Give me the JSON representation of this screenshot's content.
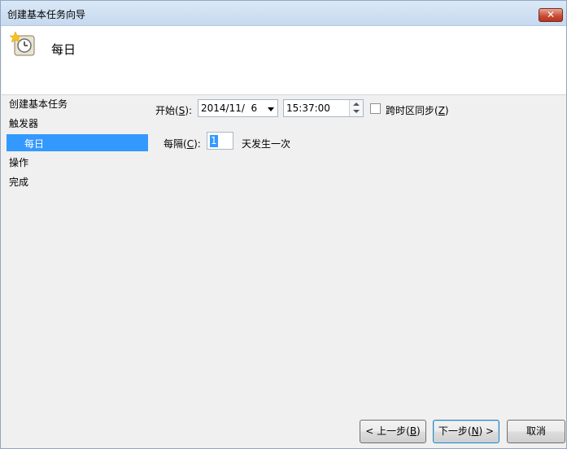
{
  "window": {
    "title": "创建基本任务向导",
    "close_label": "✕"
  },
  "header": {
    "title": "每日",
    "icon": "clock-wizard-icon"
  },
  "nav": {
    "items": [
      {
        "label": "创建基本任务",
        "selected": false
      },
      {
        "label": "触发器",
        "selected": false
      },
      {
        "label": "每日",
        "selected": true
      },
      {
        "label": "操作",
        "selected": false
      },
      {
        "label": "完成",
        "selected": false
      }
    ]
  },
  "form": {
    "start_label_pre": "开始(",
    "start_label_key": "S",
    "start_label_post": "):",
    "start_date": "2014/11/  6",
    "start_time": "15:37:00",
    "sync_label_pre": "跨时区同步(",
    "sync_label_key": "Z",
    "sync_label_post": ")",
    "sync_checked": false,
    "recur_label_pre": "每隔(",
    "recur_label_key": "C",
    "recur_label_post": "):",
    "recur_value": "1",
    "recur_suffix": "天发生一次"
  },
  "buttons": {
    "back_pre": "< 上一步(",
    "back_key": "B",
    "back_post": ")",
    "next_pre": "下一步(",
    "next_key": "N",
    "next_post": ") >",
    "cancel": "取消"
  }
}
